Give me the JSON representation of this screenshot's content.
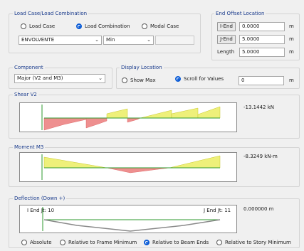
{
  "load_case": {
    "title": "Load Case/Load Combination",
    "options": [
      {
        "label": "Load Case",
        "selected": false
      },
      {
        "label": "Load Combination",
        "selected": true
      },
      {
        "label": "Modal Case",
        "selected": false
      }
    ],
    "combo_value": "ENVOLVENTE",
    "minmax_value": "Min",
    "extra_value": ""
  },
  "end_offset": {
    "title": "End Offset Location",
    "iend_label": "I-End",
    "iend_value": "0.0000",
    "jend_label": "J-End",
    "jend_value": "5.0000",
    "length_label": "Length",
    "length_value": "5.0000",
    "unit": "m"
  },
  "component": {
    "title": "Component",
    "value": "Major (V2 and M3)"
  },
  "display_location": {
    "title": "Display Location",
    "options": [
      {
        "label": "Show Max",
        "selected": false
      },
      {
        "label": "Scroll for Values",
        "selected": true
      }
    ],
    "value": "0",
    "unit": "m"
  },
  "shear": {
    "title": "Shear V2",
    "value_text": "-13.1442 kN",
    "colors": {
      "positive": "#eef07a",
      "negative": "#ee8f8f",
      "stroke": "#2d9a2d"
    }
  },
  "moment": {
    "title": "Moment M3",
    "value_text": "-8.3249 kN-m"
  },
  "deflection": {
    "title": "Deflection (Down +)",
    "iend_text": "I End Jt: 10",
    "jend_text": "J End Jt: 11",
    "value_text": "0.000000 m",
    "options": [
      {
        "label": "Absolute",
        "selected": false
      },
      {
        "label": "Relative to Frame Minimum",
        "selected": false
      },
      {
        "label": "Relative to Beam Ends",
        "selected": true
      },
      {
        "label": "Relative to Story Minimum",
        "selected": false
      }
    ]
  }
}
